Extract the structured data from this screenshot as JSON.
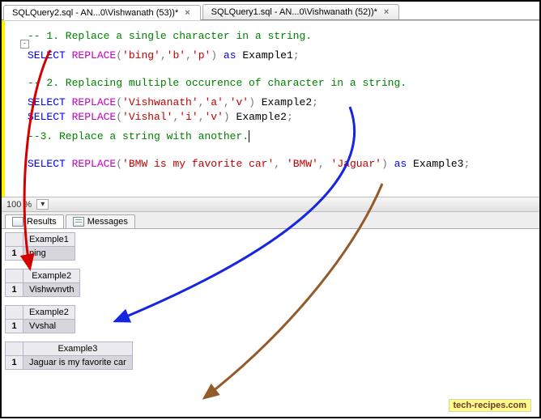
{
  "tabs": [
    {
      "label": "SQLQuery2.sql - AN...0\\Vishwanath (53))*"
    },
    {
      "label": "SQLQuery1.sql - AN...0\\Vishwanath (52))*"
    }
  ],
  "zoom": {
    "value": "100 %"
  },
  "code": {
    "c1": "-- 1. Replace a single character in a string.",
    "s1": {
      "select": "SELECT",
      "func": "REPLACE",
      "open": "(",
      "a1": "'bing'",
      "comma1": ",",
      "a2": "'b'",
      "comma2": ",",
      "a3": "'p'",
      "close": ")",
      "as": "as",
      "alias": "Example1",
      "semi": ";"
    },
    "c2": "-- 2. Replacing multiple occurence of character in a string.",
    "s2": {
      "select": "SELECT",
      "func": "REPLACE",
      "open": "(",
      "a1": "'Vishwanath'",
      "comma1": ",",
      "a2": "'a'",
      "comma2": ",",
      "a3": "'v'",
      "close": ")",
      "alias": "Example2",
      "semi": ";"
    },
    "s3": {
      "select": "SELECT",
      "func": "REPLACE",
      "open": "(",
      "a1": "'Vishal'",
      "comma1": ",",
      "a2": "'i'",
      "comma2": ",",
      "a3": "'v'",
      "close": ")",
      "alias": "Example2",
      "semi": ";"
    },
    "c3": "--3. Replace a string with another.",
    "s4": {
      "select": "SELECT",
      "func": "REPLACE",
      "open": "(",
      "a1": "'BMW is my favorite car'",
      "comma1": ",",
      "a2": "'BMW'",
      "comma2": ",",
      "a3": "'Jaguar'",
      "close": ")",
      "as": "as",
      "alias": "Example3",
      "semi": ";"
    }
  },
  "resultTabs": {
    "results": "Results",
    "messages": "Messages"
  },
  "grids": [
    {
      "header": "Example1",
      "rownum": "1",
      "value": "ping"
    },
    {
      "header": "Example2",
      "rownum": "1",
      "value": "Vishwvnvth"
    },
    {
      "header": "Example2",
      "rownum": "1",
      "value": "Vvshal"
    },
    {
      "header": "Example3",
      "rownum": "1",
      "value": "Jaguar is my favorite car"
    }
  ],
  "watermark": "tech-recipes.com"
}
